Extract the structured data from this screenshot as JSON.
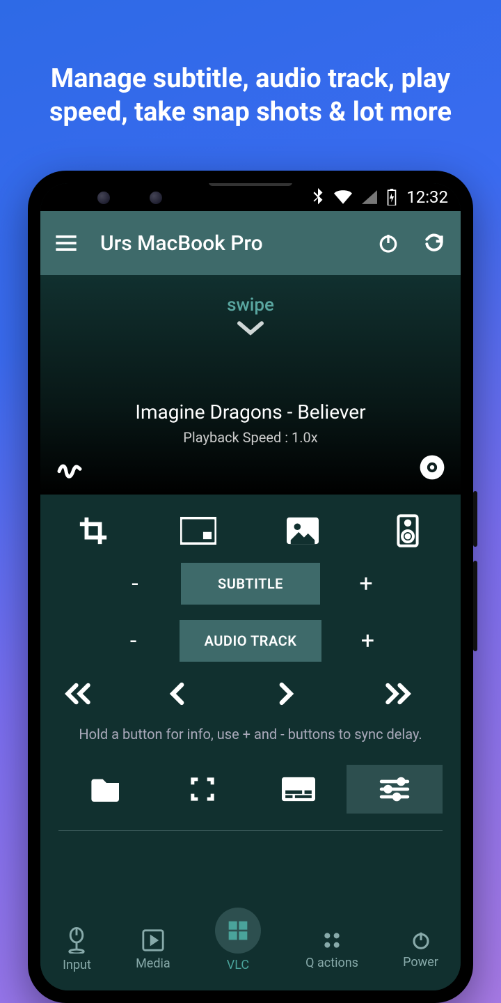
{
  "headline": "Manage subtitle, audio track, play speed, take snap shots & lot more",
  "status": {
    "time": "12:32"
  },
  "appbar": {
    "title": "Urs MacBook Pro"
  },
  "swipe": {
    "label": "swipe"
  },
  "track": {
    "title": "Imagine Dragons - Believer",
    "speed_label": "Playback Speed : 1.0x"
  },
  "controls": {
    "subtitle_button": "SUBTITLE",
    "audio_button": "AUDIO TRACK",
    "minus": "-",
    "plus": "+",
    "hint": "Hold a button for info, use + and - buttons to sync delay."
  },
  "nav": {
    "items": [
      {
        "label": "Input"
      },
      {
        "label": "Media"
      },
      {
        "label": "VLC"
      },
      {
        "label": "Q actions"
      },
      {
        "label": "Power"
      }
    ]
  }
}
